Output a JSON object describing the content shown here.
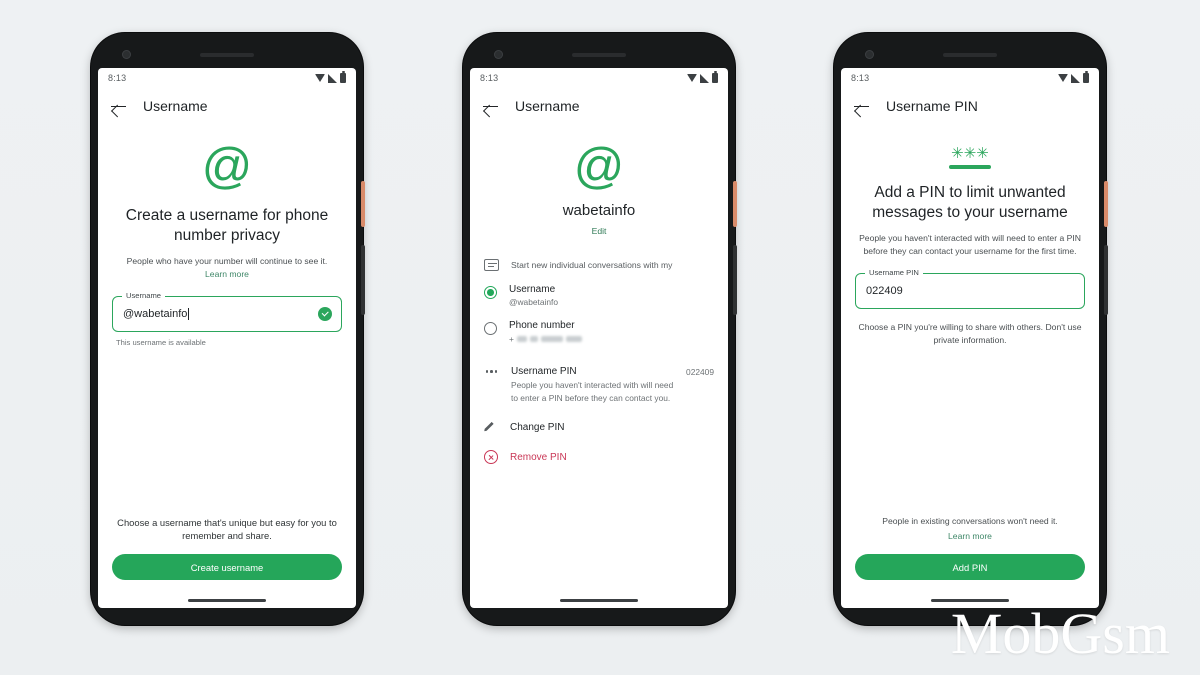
{
  "background_color": "#edf0f2",
  "accent_green": "#2ba65c",
  "danger_red": "#c93756",
  "watermark": "MobGsm",
  "status_bar": {
    "time": "8:13"
  },
  "phone1": {
    "appbar_title": "Username",
    "logo_glyph": "@",
    "headline": "Create a username for phone number privacy",
    "subtitle": "People who have your number will continue to see it.",
    "learn_more": "Learn more",
    "field_label": "Username",
    "field_value": "@wabetainfo",
    "helper_text": "This username is available",
    "footnote": "Choose a username that's unique but easy for you to remember and share.",
    "cta_label": "Create username"
  },
  "phone2": {
    "appbar_title": "Username",
    "logo_glyph": "@",
    "profile_name": "wabetainfo",
    "edit_label": "Edit",
    "section_heading": "Start new individual conversations with my",
    "options": [
      {
        "title": "Username",
        "subtitle": "@wabetainfo",
        "selected": true
      },
      {
        "title": "Phone number",
        "subtitle": "+",
        "selected": false
      }
    ],
    "pin_item": {
      "title": "Username PIN",
      "code": "022409",
      "description": "People you haven't interacted with will need to enter a PIN before they can contact you."
    },
    "actions": [
      {
        "label": "Change PIN",
        "style": "normal"
      },
      {
        "label": "Remove PIN",
        "style": "danger"
      }
    ]
  },
  "phone3": {
    "appbar_title": "Username PIN",
    "logo_stars": "✳✳✳",
    "headline": "Add a PIN to limit unwanted messages to your username",
    "subtitle": "People you haven't interacted with will need to enter a PIN before they can contact your username for the first time.",
    "field_label": "Username PIN",
    "field_value": "022409",
    "helper_text": "Choose a PIN you're willing to share with others. Don't use private information.",
    "footnote": "People in existing conversations won't need it.",
    "learn_more": "Learn more",
    "cta_label": "Add PIN"
  }
}
